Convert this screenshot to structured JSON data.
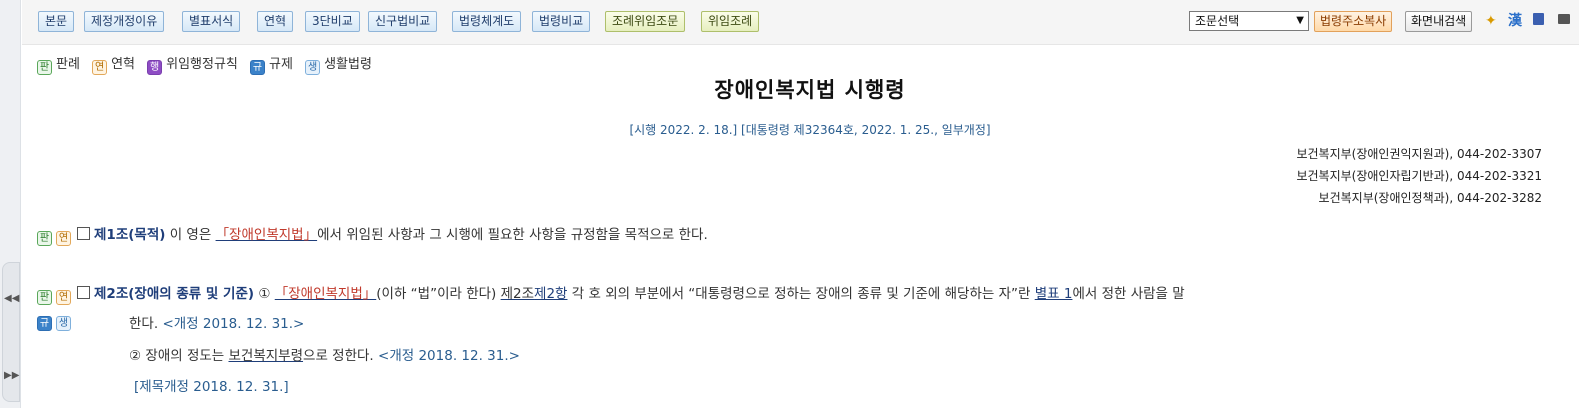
{
  "toolbar": {
    "buttons": [
      "본문",
      "제정개정이유",
      "별표서식",
      "연혁",
      "3단비교",
      "신구법비교",
      "법령체계도",
      "법령비교"
    ],
    "green_buttons": [
      "조례위임조문",
      "위임조례"
    ],
    "select_value": "조문선택",
    "copy_button": "법령주소복사",
    "search_button": "화면내검색",
    "icons": [
      "star-icon",
      "hanja-icon",
      "save-icon",
      "print-icon"
    ],
    "hanja_glyph": "漢"
  },
  "legend": [
    {
      "badge": "판",
      "label": "판례"
    },
    {
      "badge": "연",
      "label": "연혁"
    },
    {
      "badge": "행",
      "label": "위임행정규칙"
    },
    {
      "badge": "규",
      "label": "규제"
    },
    {
      "badge": "생",
      "label": "생활법령"
    }
  ],
  "document": {
    "title": "장애인복지법 시행령",
    "enforcement": "[시행 2022. 2. 18.] [대통령령 제32364호, 2022. 1. 25., 일부개정]",
    "departments": [
      "보건복지부(장애인권익지원과), 044-202-3307",
      "보건복지부(장애인자립기반과), 044-202-3321",
      "보건복지부(장애인정책과), 044-202-3282"
    ]
  },
  "articles": {
    "a1": {
      "badges": [
        "판",
        "연"
      ],
      "heading": "제1조(목적)",
      "text_before": " 이 영은 ",
      "law_link": "「장애인복지법」",
      "text_after": "에서 위임된 사항과 그 시행에 필요한 사항을 규정함을 목적으로 한다."
    },
    "a2": {
      "badges": [
        "판",
        "연"
      ],
      "badges_second": [
        "규",
        "생"
      ],
      "heading": "제2조(장애의 종류 및 기준)",
      "para1_num": " ① ",
      "law_link": "「장애인복지법」",
      "text1": "(이하 “법”이라 한다) ",
      "art_link": "제2조",
      "para_link": "제2항",
      "text2": " 각 호 외의 부분에서 “대통령령으로 정하는 장애의 종류 및 기준에 해당하는 자”란 ",
      "annex_link": "별표 1",
      "text3": "에서 정한 사람을 말",
      "line2_text": "한다. ",
      "line2_tag": "<개정 2018. 12. 31.>",
      "para2_text": "② 장애의 정도는 ",
      "para2_link": "보건복지부령",
      "para2_after": "으로 정한다. ",
      "para2_tag": "<개정 2018. 12. 31.>",
      "title_tag": "[제목개정 2018. 12. 31.]"
    }
  },
  "colors": {
    "accent": "#1f3e7a",
    "law_link": "#c0392b",
    "meta_blue": "#2a5d8f"
  }
}
